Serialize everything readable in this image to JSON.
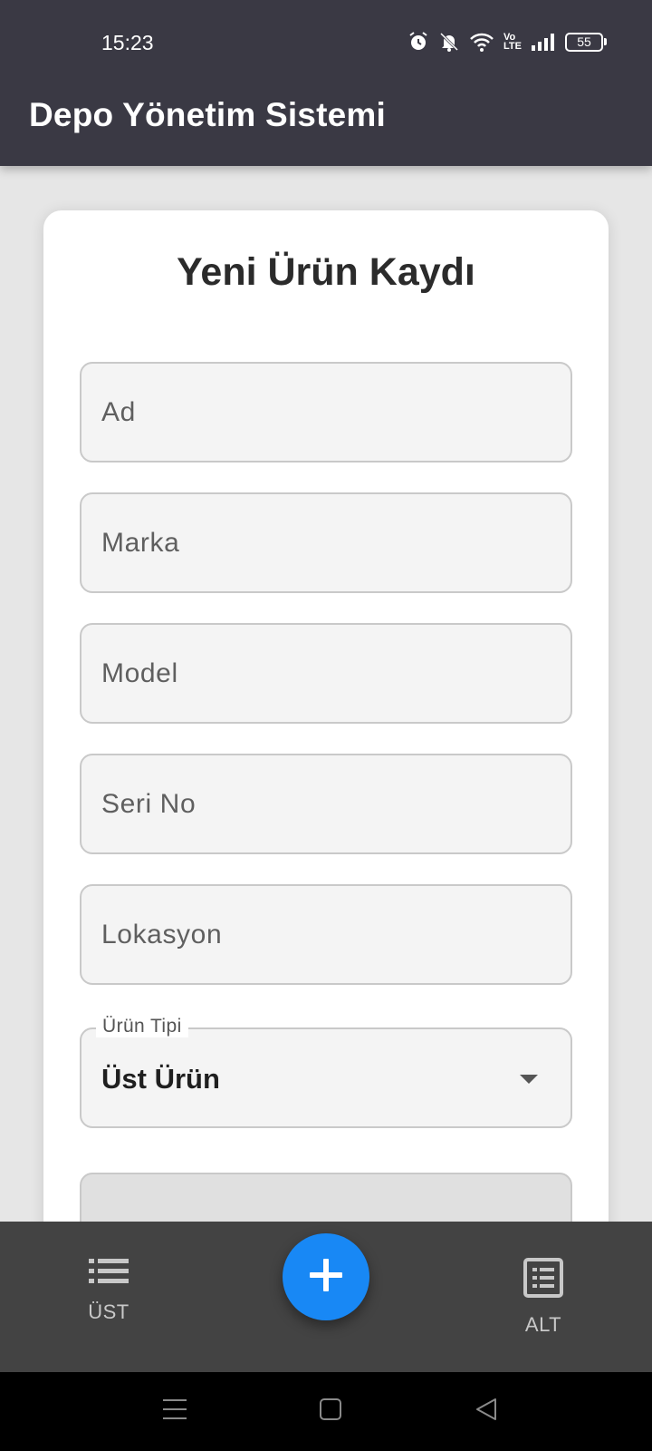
{
  "status_bar": {
    "time": "15:23",
    "battery": "55",
    "network_label_top": "Vo",
    "network_label_bottom": "LTE",
    "icons": [
      "alarm-icon",
      "muted-bell-icon",
      "wifi-icon",
      "volte-icon",
      "signal-icon",
      "battery-icon"
    ]
  },
  "app_bar": {
    "title": "Depo Yönetim Sistemi"
  },
  "form": {
    "title": "Yeni Ürün Kaydı",
    "fields": {
      "ad": {
        "placeholder": "Ad",
        "value": ""
      },
      "marka": {
        "placeholder": "Marka",
        "value": ""
      },
      "model": {
        "placeholder": "Model",
        "value": ""
      },
      "seri_no": {
        "placeholder": "Seri No",
        "value": ""
      },
      "lokasyon": {
        "placeholder": "Lokasyon",
        "value": ""
      }
    },
    "urun_tipi": {
      "label": "Ürün Tipi",
      "value": "Üst Ürün"
    }
  },
  "bottom_nav": {
    "left": {
      "label": "ÜST",
      "icon": "list-icon"
    },
    "fab": {
      "icon": "plus-icon"
    },
    "right": {
      "label": "ALT",
      "icon": "list-box-icon"
    }
  },
  "system_nav": {
    "icons": [
      "menu-icon",
      "home-icon",
      "back-icon"
    ]
  },
  "colors": {
    "app_bar": "#3a3944",
    "fab": "#1888f5",
    "bottom_bar": "#434343",
    "field_bg": "#f4f4f4"
  }
}
